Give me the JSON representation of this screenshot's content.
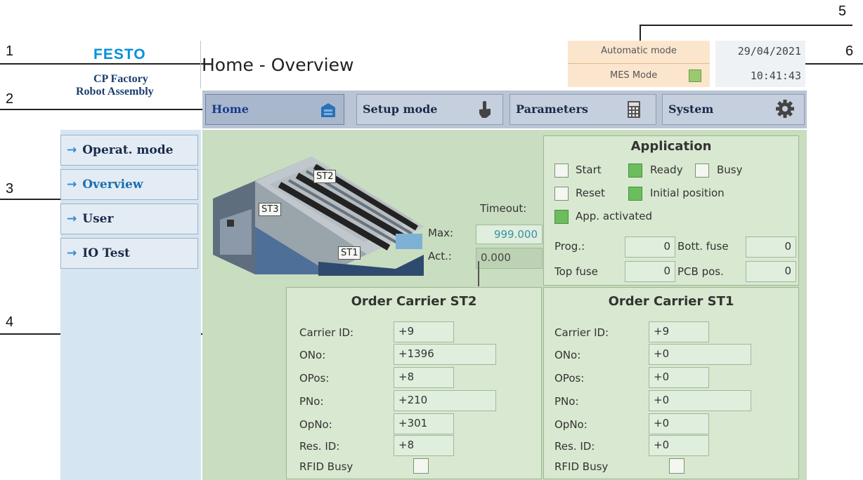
{
  "callouts": [
    "1",
    "2",
    "3",
    "4",
    "5",
    "6"
  ],
  "logo": {
    "brand": "FESTO",
    "line1": "CP Factory",
    "line2": "Robot Assembly"
  },
  "header": {
    "title": "Home - Overview",
    "mode_label": "Automatic mode",
    "mes_label": "MES Mode",
    "date": "29/04/2021",
    "time": "10:41:43"
  },
  "nav": {
    "tabs": [
      {
        "label": "Home",
        "icon": "home-icon"
      },
      {
        "label": "Setup mode",
        "icon": "hand-pointer-icon"
      },
      {
        "label": "Parameters",
        "icon": "calculator-icon"
      },
      {
        "label": "System",
        "icon": "gear-icon"
      }
    ]
  },
  "sidebar": {
    "items": [
      {
        "label": "Operat. mode"
      },
      {
        "label": "Overview"
      },
      {
        "label": "User"
      },
      {
        "label": "IO Test"
      }
    ]
  },
  "station": {
    "tags": [
      "ST2",
      "ST3",
      "ST1"
    ],
    "timeout_label": "Timeout:",
    "max_label": "Max:",
    "max_value": "999.000",
    "act_label": "Act.:",
    "act_value": "0.000"
  },
  "application": {
    "title": "Application",
    "start": "Start",
    "ready": "Ready",
    "busy": "Busy",
    "reset": "Reset",
    "initial_position": "Initial position",
    "app_activated": "App. activated",
    "prog_label": "Prog.:",
    "prog_value": "0",
    "bott_fuse_label": "Bott. fuse",
    "bott_fuse_value": "0",
    "top_fuse_label": "Top fuse",
    "top_fuse_value": "0",
    "pcb_pos_label": "PCB pos.",
    "pcb_pos_value": "0"
  },
  "order_st2": {
    "title": "Order Carrier ST2",
    "carrier_id_label": "Carrier ID:",
    "carrier_id": "+9",
    "ono_label": "ONo:",
    "ono": "+1396",
    "opos_label": "OPos:",
    "opos": "+8",
    "pno_label": "PNo:",
    "pno": "+210",
    "opno_label": "OpNo:",
    "opno": "+301",
    "resid_label": "Res. ID:",
    "resid": "+8",
    "rfid_label": "RFID Busy"
  },
  "order_st1": {
    "title": "Order Carrier ST1",
    "carrier_id_label": "Carrier ID:",
    "carrier_id": "+9",
    "ono_label": "ONo:",
    "ono": "+0",
    "opos_label": "OPos:",
    "opos": "+0",
    "pno_label": "PNo:",
    "pno": "+0",
    "opno_label": "OpNo:",
    "opno": "+0",
    "resid_label": "Res. ID:",
    "resid": "+0",
    "rfid_label": "RFID Busy"
  },
  "colors": {
    "nav_bar": "#b9c4d4",
    "main_bg": "#c9ddc0",
    "led_green": "#6bbd5e",
    "mode_bg": "#fbe6cd",
    "festo_blue": "#0091dc"
  }
}
